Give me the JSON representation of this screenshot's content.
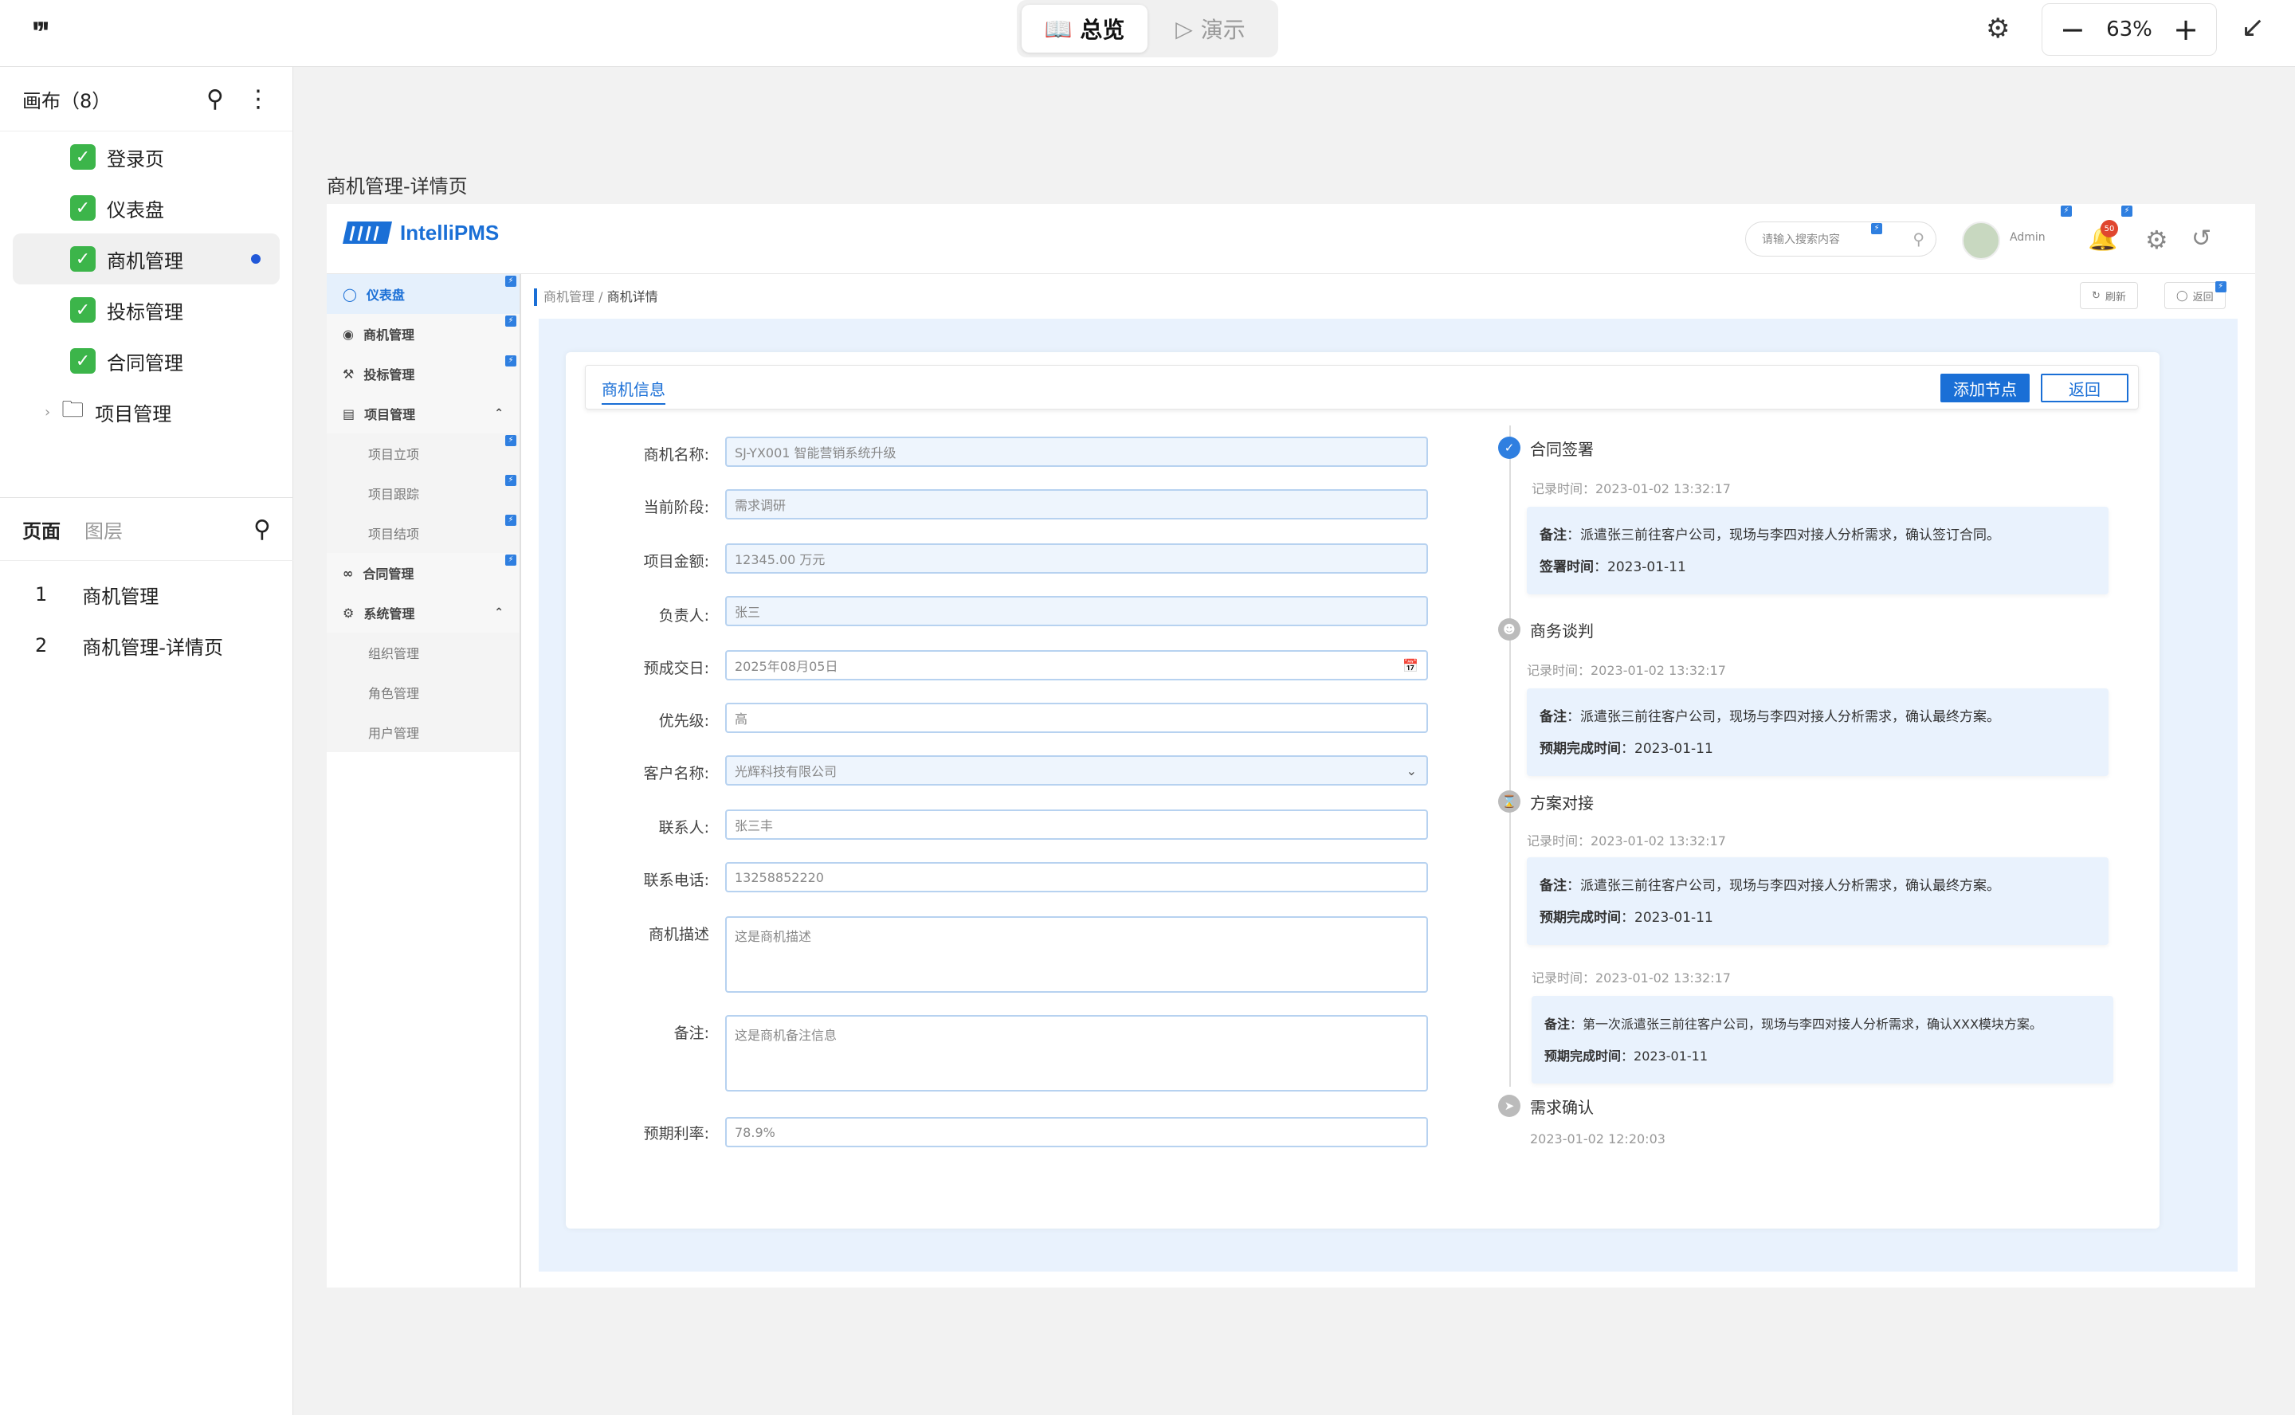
{
  "topbar": {
    "logo": "'ʼ'",
    "mode_overview": "总览",
    "mode_present": "演示",
    "zoom": "63%"
  },
  "left_panel": {
    "canvas_header": "画布（8）",
    "canvas_items": [
      {
        "label": "登录页",
        "checked": true
      },
      {
        "label": "仪表盘",
        "checked": true
      },
      {
        "label": "商机管理",
        "checked": true,
        "selected": true
      },
      {
        "label": "投标管理",
        "checked": true
      },
      {
        "label": "合同管理",
        "checked": true
      },
      {
        "label": "项目管理",
        "folder": true
      }
    ],
    "tab_pages": "页面",
    "tab_layers": "图层",
    "pages": [
      {
        "num": "1",
        "label": "商机管理"
      },
      {
        "num": "2",
        "label": "商机管理-详情页"
      }
    ]
  },
  "canvas": {
    "frame_title": "商机管理-详情页"
  },
  "app": {
    "brand": "IntelliPMS",
    "search_placeholder": "请输入搜索内容",
    "user": "Admin",
    "notif_count": "50",
    "nav": [
      {
        "label": "仪表盘",
        "active": true
      },
      {
        "label": "商机管理"
      },
      {
        "label": "投标管理"
      },
      {
        "label": "项目管理",
        "expand": true
      },
      {
        "label": "项目立项",
        "sub": true
      },
      {
        "label": "项目跟踪",
        "sub": true
      },
      {
        "label": "项目结项",
        "sub": true
      },
      {
        "label": "合同管理"
      },
      {
        "label": "系统管理",
        "expand": true
      },
      {
        "label": "组织管理",
        "sub": true
      },
      {
        "label": "角色管理",
        "sub": true
      },
      {
        "label": "用户管理",
        "sub": true
      }
    ],
    "breadcrumb_parent": "商机管理",
    "breadcrumb_current": "商机详情",
    "btn_refresh": "刷新",
    "btn_back_top": "返回",
    "card_tab": "商机信息",
    "btn_add_node": "添加节点",
    "btn_back": "返回",
    "form": [
      {
        "label": "商机名称:",
        "value": "SJ-YX001   智能营销系统升级"
      },
      {
        "label": "当前阶段:",
        "value": "需求调研"
      },
      {
        "label": "项目金额:",
        "value": "12345.00  万元"
      },
      {
        "label": "负责人:",
        "value": "张三"
      },
      {
        "label": "预成交日:",
        "value": "2025年08月05日"
      },
      {
        "label": "优先级:",
        "value": "高"
      },
      {
        "label": "客户名称:",
        "value": "光辉科技有限公司"
      },
      {
        "label": "联系人:",
        "value": "张三丰"
      },
      {
        "label": "联系电话:",
        "value": "13258852220"
      },
      {
        "label": "商机描述",
        "value": "这是商机描述"
      },
      {
        "label": "备注:",
        "value": "这是商机备注信息"
      },
      {
        "label": "预期利率:",
        "value": "78.9%"
      }
    ],
    "timeline": {
      "n1_title": "合同签署",
      "n1_time": "记录时间：2023-01-02 13:32:17",
      "n1_note_k": "备注",
      "n1_note": "：派遣张三前往客户公司，现场与李四对接人分析需求，确认签订合同。",
      "n1_date_k": "签署时间",
      "n1_date": "：2023-01-11",
      "n2_title": "商务谈判",
      "n2_time": "记录时间：2023-01-02 13:32:17",
      "n2_note_k": "备注",
      "n2_note": "：派遣张三前往客户公司，现场与李四对接人分析需求，确认最终方案。",
      "n2_date_k": "预期完成时间",
      "n2_date": "：2023-01-11",
      "n3_title": "方案对接",
      "n3_time": "记录时间：2023-01-02 13:32:17",
      "n3_note_k": "备注",
      "n3_note": "：派遣张三前往客户公司，现场与李四对接人分析需求，确认最终方案。",
      "n3_date_k": "预期完成时间",
      "n3_date": "：2023-01-11",
      "n4_time": "记录时间：2023-01-02 13:32:17",
      "n4_note_k": "备注",
      "n4_note": "：第一次派遣张三前往客户公司，现场与李四对接人分析需求，确认XXX模块方案。",
      "n4_date_k": "预期完成时间",
      "n4_date": "：2023-01-11",
      "n5_title": "需求确认",
      "n5_time": "2023-01-02 12:20:03"
    }
  }
}
